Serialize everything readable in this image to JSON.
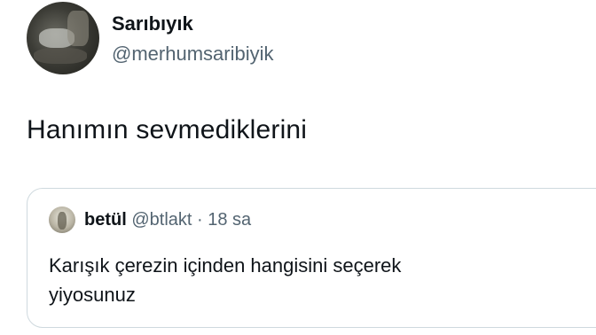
{
  "tweet": {
    "display_name": "Sarıbıyık",
    "handle": "@merhumsaribiyik",
    "text": "Hanımın sevmediklerini",
    "avatar_icon": "profile-photo"
  },
  "quoted_tweet": {
    "display_name": "betül",
    "handle": "@btlakt",
    "separator": "·",
    "time": "18 sa",
    "text_line1": "Karışık çerezin içinden hangisini seçerek",
    "text_line2": "yiyosunuz",
    "avatar_icon": "profile-photo"
  }
}
